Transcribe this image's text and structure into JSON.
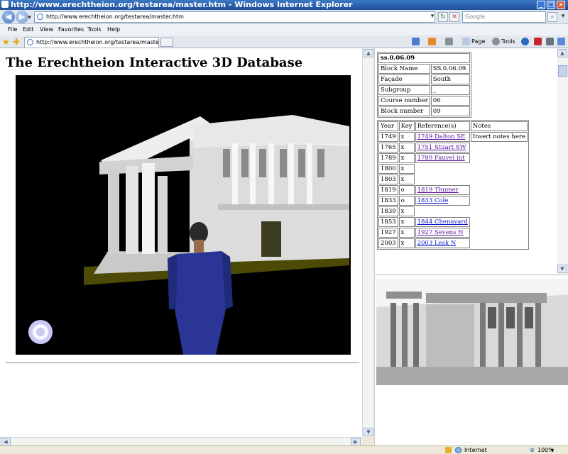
{
  "window": {
    "title": "http://www.erechtheion.org/testarea/master.htm - Windows Internet Explorer"
  },
  "addressbar": {
    "url": "http://www.erechtheion.org/testarea/master.htm",
    "search_placeholder": "Google"
  },
  "menu": [
    "File",
    "Edit",
    "View",
    "Favorites",
    "Tools",
    "Help"
  ],
  "tab": {
    "label": "http://www.erechtheion.org/testarea/master.htm"
  },
  "toolbar": {
    "page_label": "Page",
    "tools_label": "Tools"
  },
  "page": {
    "title": "The Erechtheion Interactive 3D Database"
  },
  "block_info": {
    "id": "ss.0.06.09",
    "rows": [
      {
        "label": "Block Name",
        "value": "SS.0.06.09."
      },
      {
        "label": "Façade",
        "value": "South"
      },
      {
        "label": "Subgroup",
        "value": "_"
      },
      {
        "label": "Course number",
        "value": "06"
      },
      {
        "label": "Block number",
        "value": "09"
      }
    ]
  },
  "references": {
    "headers": [
      "Year",
      "Key",
      "Reference(s)",
      "Notes"
    ],
    "rows": [
      {
        "year": "1749",
        "key": "x",
        "ref": "1749 Dalton SE",
        "note": "Insert notes here"
      },
      {
        "year": "1765",
        "key": "x",
        "ref": "1751 Stuart SW",
        "note": ""
      },
      {
        "year": "1789",
        "key": "x",
        "ref": "1789 Fauvel int",
        "note": ""
      },
      {
        "year": "1800",
        "key": "x",
        "ref": "",
        "note": ""
      },
      {
        "year": "1803",
        "key": "x",
        "ref": "",
        "note": ""
      },
      {
        "year": "1819",
        "key": "o",
        "ref": "1819 Thumer",
        "note": ""
      },
      {
        "year": "1833",
        "key": "o",
        "ref": "1833 Cole",
        "note": ""
      },
      {
        "year": "1839",
        "key": "x",
        "ref": "",
        "note": ""
      },
      {
        "year": "1853",
        "key": "x",
        "ref": "1844 Chenavard",
        "note": ""
      },
      {
        "year": "1927",
        "key": "x",
        "ref": "1927 Sevens N",
        "note": ""
      },
      {
        "year": "2003",
        "key": "x",
        "ref": "2003 Lesk N",
        "note": ""
      }
    ]
  },
  "statusbar": {
    "zone": "Internet",
    "zoom": "100%"
  },
  "colors": {
    "visited_link": "#5b0f9e",
    "link": "#0b14c8",
    "ie_blue": "#1f4f9b"
  }
}
